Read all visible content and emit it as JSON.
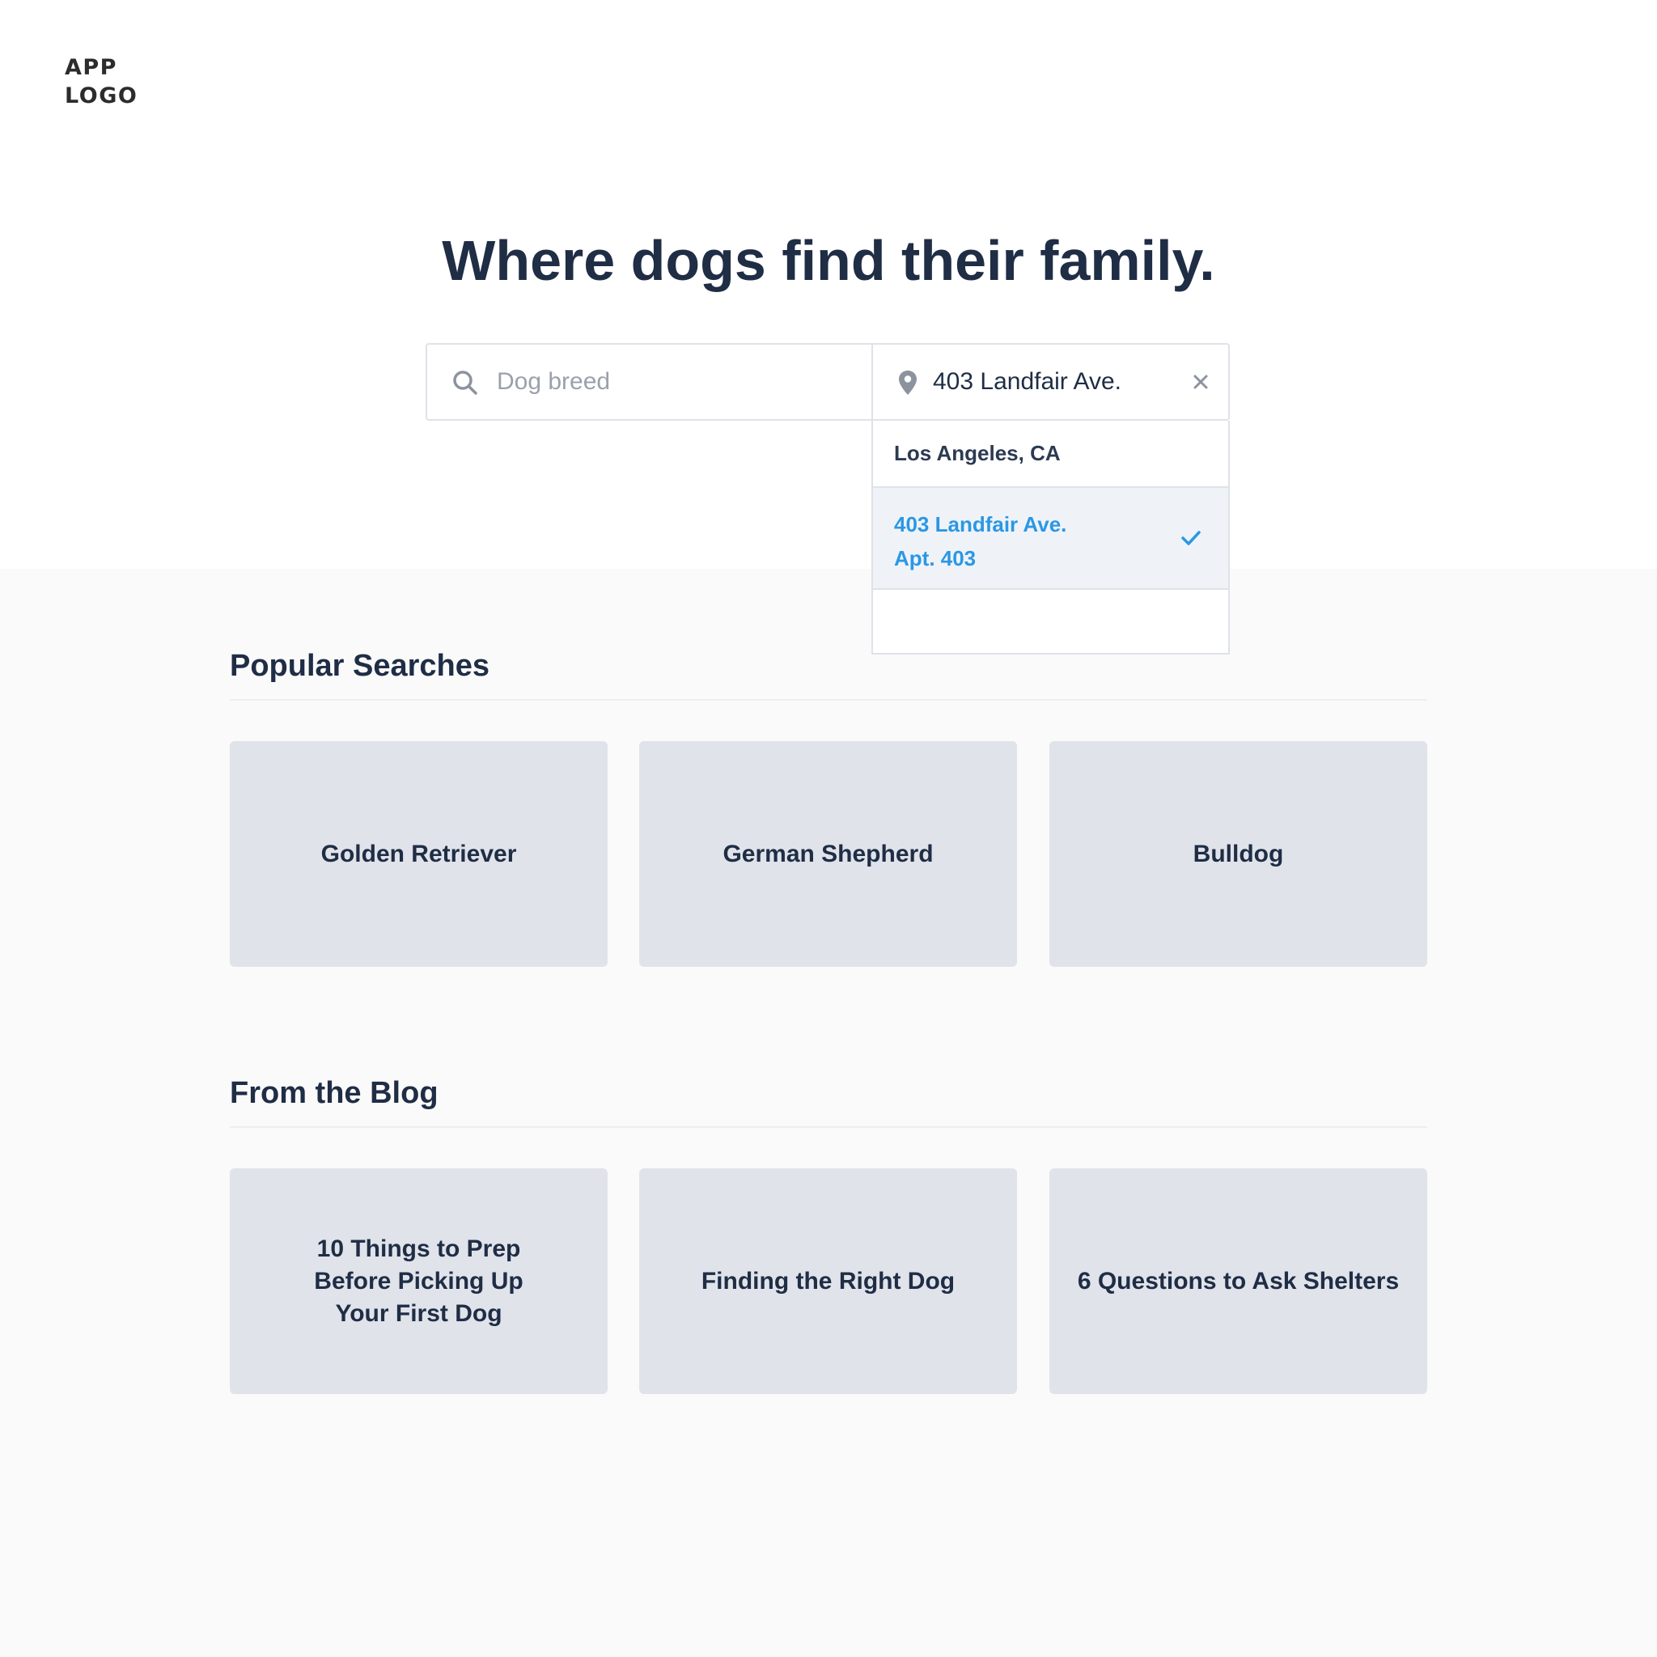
{
  "logo": {
    "line1": "APP",
    "line2": "LOGO"
  },
  "headline": "Where dogs find their family.",
  "search": {
    "breed_placeholder": "Dog breed",
    "location_value": "403 Landfair Ave.",
    "location_suggestions": [
      {
        "line1": "Los Angeles, CA"
      },
      {
        "line1": "403 Landfair Ave.",
        "line2": "Apt. 403",
        "selected": true
      }
    ]
  },
  "popular_searches": {
    "title": "Popular Searches",
    "items": [
      "Golden Retriever",
      "German Shepherd",
      "Bulldog"
    ]
  },
  "blog": {
    "title": "From the Blog",
    "items": [
      "10 Things to Prep Before Picking Up Your First Dog",
      "Finding the Right Dog",
      "6 Questions to Ask Shelters"
    ]
  },
  "colors": {
    "text": "#1f2d45",
    "card": "#e0e3ea",
    "accent": "#2b97e4",
    "selected_bg": "#eff3f8",
    "page_bg": "#fafafa"
  },
  "icons": {
    "breed": "search-icon",
    "location": "map-pin-icon",
    "clear": "close-icon",
    "selected": "checkmark-icon"
  }
}
